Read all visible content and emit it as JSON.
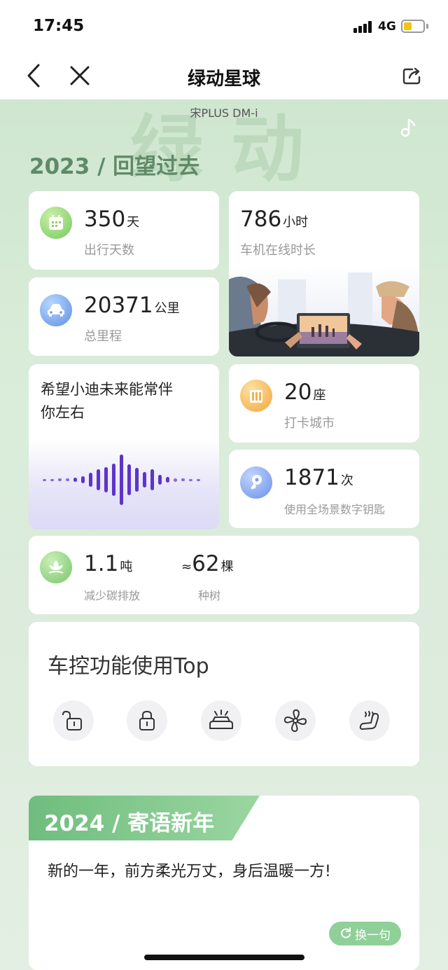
{
  "status_bar": {
    "time": "17:45",
    "network": "4G",
    "battery_color": "#f6c40d"
  },
  "nav": {
    "title": "绿动星球",
    "back_icon": "chevron-left-icon",
    "close_icon": "close-icon",
    "share_icon": "share-icon"
  },
  "hero": {
    "watermark": "绿动",
    "car_model": "宋PLUS DM-i",
    "year_title": "2023 / 回望过去"
  },
  "stats": {
    "days": {
      "value": "350",
      "unit": "天",
      "label": "出行天数"
    },
    "online": {
      "value": "786",
      "unit": "小时",
      "label": "车机在线时长"
    },
    "mileage": {
      "value": "20371",
      "unit": "公里",
      "label": "总里程"
    },
    "cities": {
      "value": "20",
      "unit": "座",
      "label": "打卡城市"
    },
    "key": {
      "value": "1871",
      "unit": "次",
      "label": "使用全场景数字钥匙"
    }
  },
  "wish": {
    "text_line1": "希望小迪未来能常伴",
    "text_line2": "你左右"
  },
  "carbon": {
    "reduction": {
      "value": "1.1",
      "unit": "吨",
      "label": "减少碳排放"
    },
    "trees": {
      "prefix": "≈",
      "value": "62",
      "unit": "棵",
      "label": "种树"
    }
  },
  "controls": {
    "title": "车控功能使用Top",
    "items": [
      "unlock-icon",
      "lock-icon",
      "car-light-icon",
      "fan-icon",
      "seat-heat-icon"
    ]
  },
  "new_year": {
    "title": "2024 / 寄语新年",
    "message": "新的一年，前方柔光万丈，身后温暖一方!",
    "swap_label": "换一句"
  },
  "colors": {
    "accent": "#6fbd7e",
    "heading": "#5f8a67",
    "wave": "#5d34c9"
  }
}
